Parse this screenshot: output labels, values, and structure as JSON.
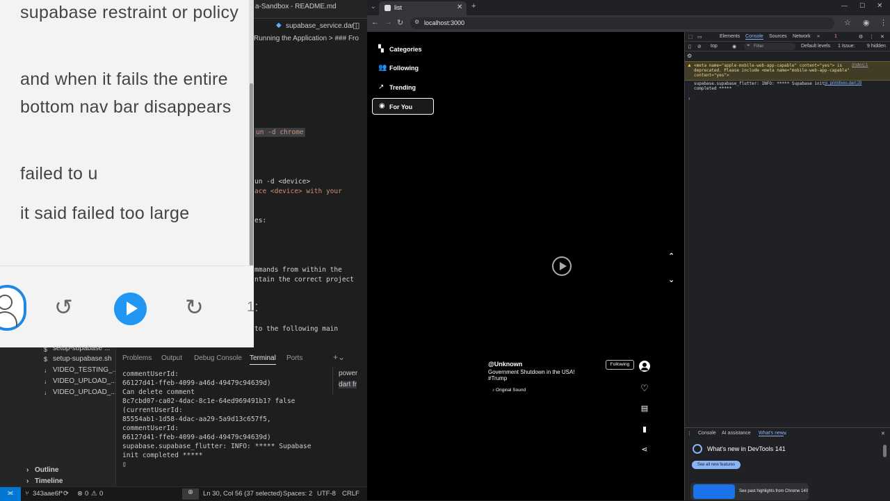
{
  "editor": {
    "title": "a-Sandbox - README.md",
    "tab_label": "supabase_service.dar",
    "breadcrumb": "Running the Application > ### Fro",
    "code": {
      "l1": "un -d chrome",
      "l2": "un -d <device>",
      "l3": "ace <device> with your",
      "l4": "es:",
      "l5": "mmands from within the",
      "l6": "ntain the correct project",
      "l7": "to the following main"
    }
  },
  "note": {
    "line1": "supabase restraint or policy",
    "line2": "and when it fails the entire bottom nav bar disappears",
    "line3": "failed to u",
    "line4": "it said failed too large"
  },
  "media": {
    "rewind_icon": "↺",
    "forward_icon": "↻",
    "speed": "1:"
  },
  "explorer": {
    "files": [
      "setup-supabase ...",
      "setup-supabase.sh",
      "VIDEO_TESTING_...",
      "VIDEO_UPLOAD_...",
      "VIDEO_UPLOAD_..."
    ],
    "outline": "Outline",
    "timeline": "Timeline"
  },
  "panel": {
    "tabs": [
      "Problems",
      "Output",
      "Debug Console",
      "Terminal",
      "Ports"
    ],
    "active_tab": "Terminal",
    "terminal_lines": [
      "commentUserId:",
      "66127d41-ffeb-4099-a46d-49479c94639d)",
      "Can delete comment",
      "8c7cbd07-ca02-4dac-8c1e-64ed969491b1? false",
      "(currentUserId:",
      "85554ab1-1d58-4dac-aa29-5a9d13c657f5,",
      "commentUserId:",
      "66127d41-ffeb-4099-a46d-49479c94639d)",
      "supabase.supabase_flutter: INFO: ***** Supabase",
      "init completed *****",
      "▯"
    ],
    "terminal_list": [
      "power",
      "dart fr"
    ]
  },
  "statusbar": {
    "branch": "343aae6f*",
    "errors": "0",
    "warnings": "0",
    "position": "Ln 30, Col 56 (37 selected)",
    "spaces": "Spaces: 2",
    "encoding": "UTF-8",
    "eol": "CRLF"
  },
  "browser": {
    "tab_title": "list",
    "url": "localhost:3000"
  },
  "app": {
    "nav": [
      "Categories",
      "Following",
      "Trending",
      "For You"
    ],
    "active_nav": "For You",
    "video": {
      "username": "@Unknown",
      "description": "Government Shutdown in the USA! #Trump",
      "sound": "♪ Original Sound",
      "follow_label": "Following"
    }
  },
  "devtools": {
    "tabs": [
      "Elements",
      "Console",
      "Sources",
      "Network"
    ],
    "active_tab": "Console",
    "issues_count": "1",
    "context": "top",
    "filter_placeholder": "Filter",
    "levels": "Default levels",
    "issue_badge": "1 Issue:",
    "hidden": "9 hidden",
    "warning_text": "<meta name=\"apple-mobile-web-app-capable\" content=\"yes\"> is deprecated. Please include <meta name=\"mobile-web-app-capable\" content=\"yes\">",
    "warning_link": "(index):1",
    "log_text": "supabase.supabase_flutter: INFO: ***** Supabase init completed *****",
    "log_link": "js_primitives.dart:28",
    "drawer_tabs": [
      "Console",
      "AI assistance",
      "What's new"
    ],
    "whats_new_title": "What's new in DevTools 141",
    "whats_new_button": "See all new features",
    "whats_new_card": "See past highlights from Chrome 140"
  },
  "colors": {
    "accent": "#2196f3",
    "vscode_blue": "#0078d4",
    "devtools_link": "#8ab4f8"
  }
}
